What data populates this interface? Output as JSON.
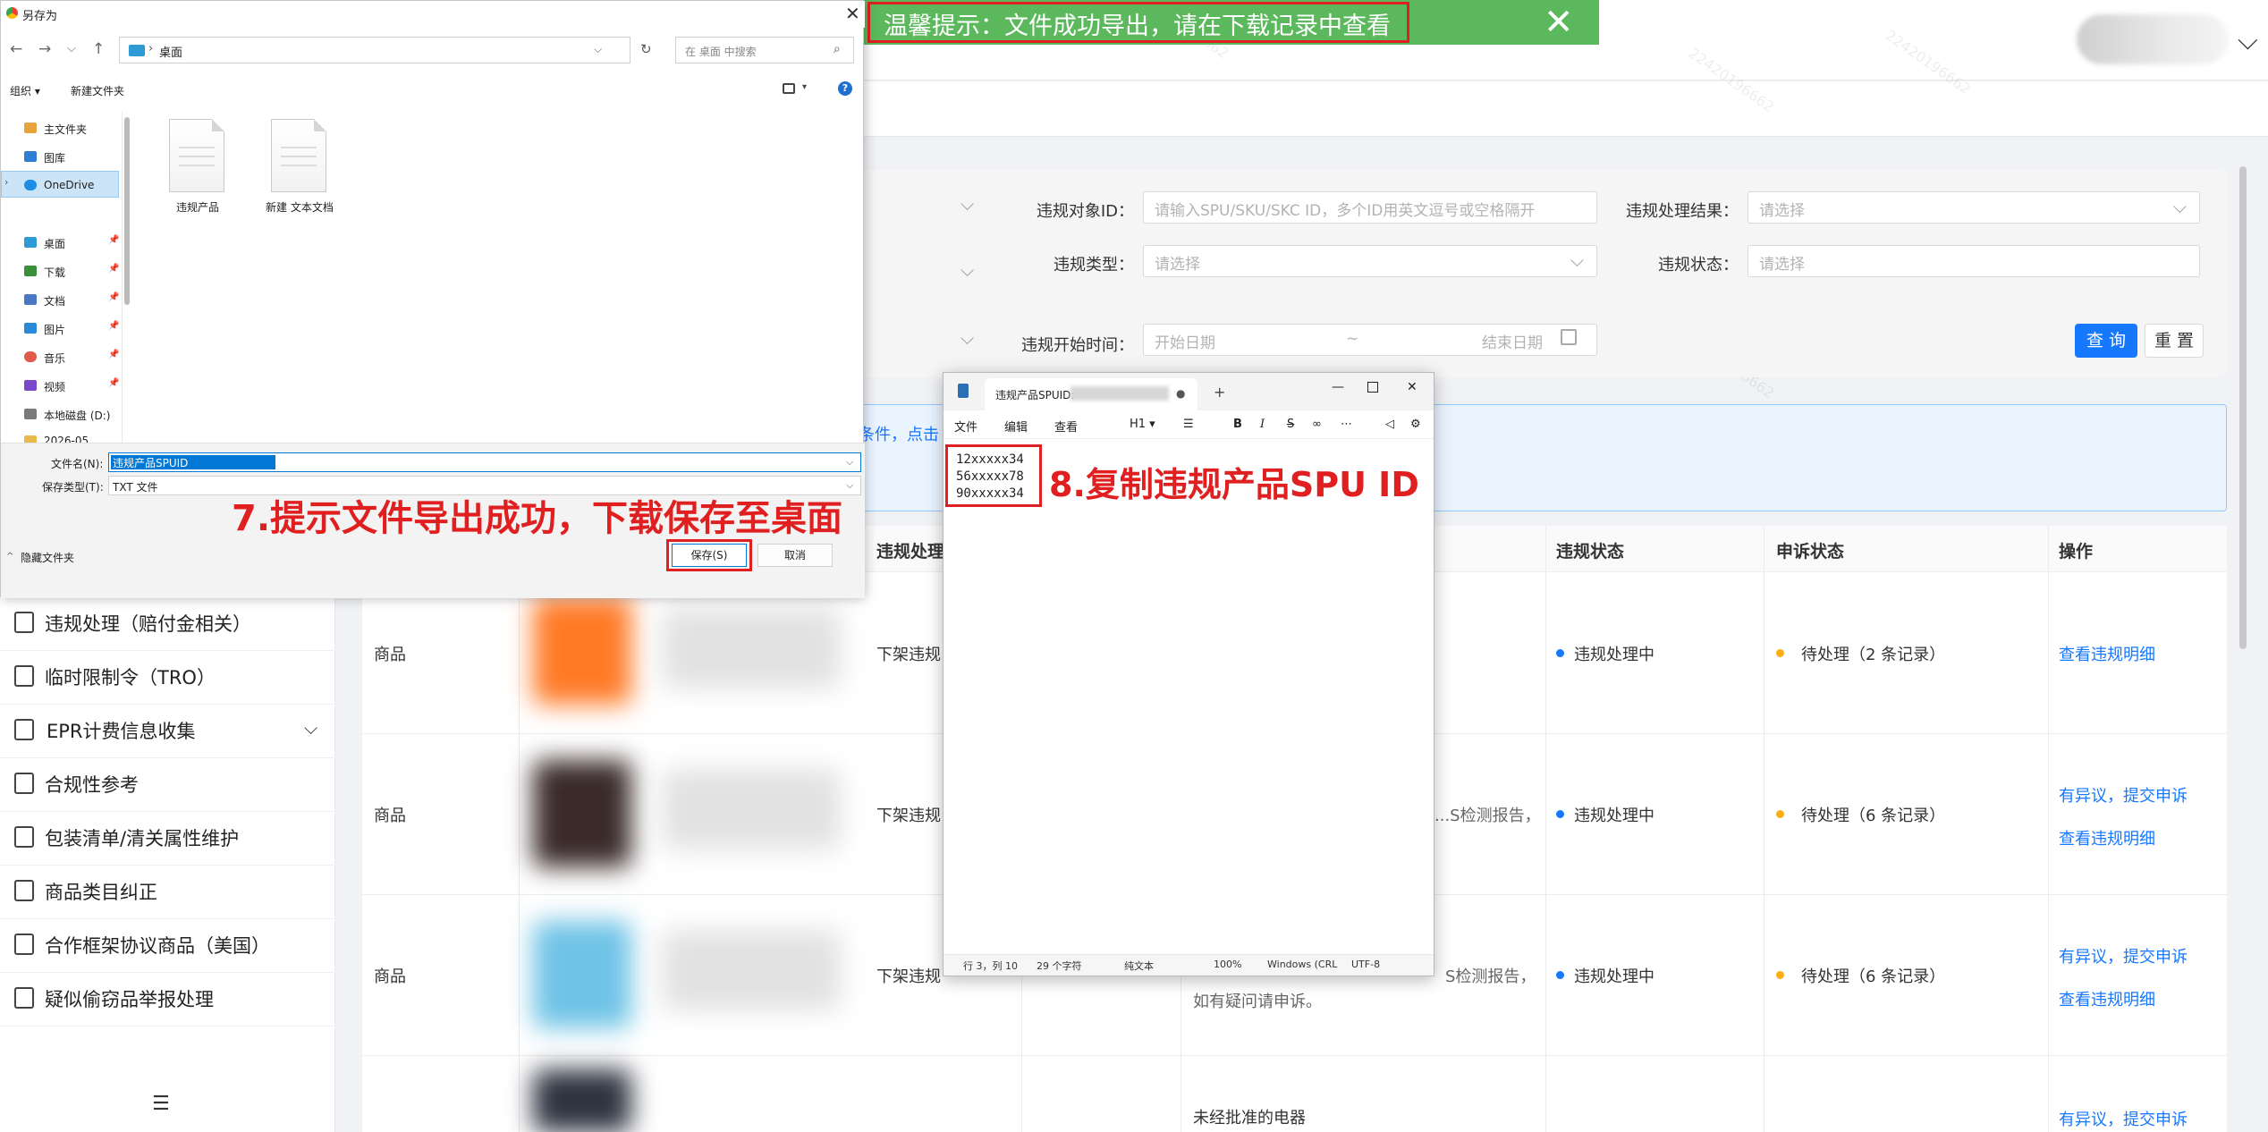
{
  "toast": {
    "text": "温馨提示：文件成功导出，请在下载记录中查看",
    "close": "✕",
    "bg_color": "#5cb85c"
  },
  "filters": {
    "violation_target_id_label": "违规对象ID：",
    "violation_target_id_placeholder": "请输入SPU/SKU/SKC ID，多个ID用英文逗号或空格隔开",
    "violation_result_label": "违规处理结果：",
    "violation_result_placeholder": "请选择",
    "violation_type_label": "违规类型：",
    "violation_type_placeholder": "请选择",
    "violation_status_label": "违规状态：",
    "violation_status_placeholder": "请选择",
    "start_time_label": "违规开始时间：",
    "start_date_placeholder": "开始日期",
    "date_separator": "~",
    "end_date_placeholder": "结束日期",
    "query_button": "查 询",
    "reset_button": "重 置"
  },
  "banner": {
    "text_fragment": "条件，点击"
  },
  "table": {
    "headers": {
      "handling": "违规处理",
      "violation_status": "违规状态",
      "appeal_status": "申诉状态",
      "actions": "操作"
    },
    "rows": [
      {
        "object": "商品",
        "handling": "下架违规",
        "reason": "",
        "violation_status": "违规处理中",
        "appeal_status": "待处理（2 条记录）",
        "actions": [
          "查看违规明细"
        ]
      },
      {
        "object": "商品",
        "handling": "下架违规",
        "reason": "...S检测报告，",
        "violation_status": "违规处理中",
        "appeal_status": "待处理（6 条记录）",
        "actions": [
          "有异议，提交申诉",
          "查看违规明细"
        ]
      },
      {
        "object": "商品",
        "handling": "下架违规",
        "reason": "S检测报告，",
        "reason2": "如有疑问请申诉。",
        "violation_status": "违规处理中",
        "appeal_status": "待处理（6 条记录）",
        "actions": [
          "有异议，提交申诉",
          "查看违规明细"
        ]
      },
      {
        "object": "商品",
        "handling": "",
        "reason": "未经批准的电器",
        "violation_status": "",
        "appeal_status": "",
        "actions": [
          "有异议，提交申诉"
        ]
      }
    ]
  },
  "sidebar": {
    "items": [
      {
        "label": "违规处理（赔付金相关）",
        "icon": "doc-icon"
      },
      {
        "label": "临时限制令（TRO）",
        "icon": "calendar-icon"
      },
      {
        "label": "EPR计费信息收集",
        "icon": "doc-search-icon",
        "expandable": true
      },
      {
        "label": "合规性参考",
        "icon": "book-icon"
      },
      {
        "label": "包装清单/清关属性维护",
        "icon": "list-icon"
      },
      {
        "label": "商品类目纠正",
        "icon": "check-doc-icon"
      },
      {
        "label": "合作框架协议商品（美国）",
        "icon": "gear-doc-icon"
      },
      {
        "label": "疑似偷窃品举报处理",
        "icon": "edit-doc-icon"
      }
    ],
    "collapse_icon": "menu-collapse-icon"
  },
  "save_dialog": {
    "title": "另存为",
    "close": "✕",
    "address": "桌面",
    "search_placeholder": "在 桌面 中搜索",
    "toolbar": {
      "organize": "组织 ▾",
      "new_folder": "新建文件夹"
    },
    "nav": [
      {
        "label": "主文件夹",
        "color": "#e8a33d",
        "pin": false
      },
      {
        "label": "图库",
        "color": "#2d7dd2",
        "pin": false
      },
      {
        "label": "OneDrive",
        "color": "#1f8ce6",
        "pin": false,
        "selected": true
      },
      {
        "label": "桌面",
        "color": "#2f9bd6",
        "pin": true
      },
      {
        "label": "下载",
        "color": "#3a8f3a",
        "pin": true
      },
      {
        "label": "文档",
        "color": "#4a78c2",
        "pin": true
      },
      {
        "label": "图片",
        "color": "#2b8ad8",
        "pin": true
      },
      {
        "label": "音乐",
        "color": "#e05a4a",
        "pin": true
      },
      {
        "label": "视频",
        "color": "#7b48c9",
        "pin": true
      },
      {
        "label": "本地磁盘 (D:)",
        "color": "#7a7a7a",
        "pin": false
      },
      {
        "label": "2026-05",
        "color": "#e8b94a",
        "pin": false
      }
    ],
    "files": [
      "违规产品",
      "新建 文本文档"
    ],
    "filename_label": "文件名(N):",
    "filename_value": "违规产品SPUID",
    "filetype_label": "保存类型(T):",
    "filetype_value": "TXT 文件",
    "hide_folders": "隐藏文件夹",
    "save_button": "保存(S)",
    "cancel_button": "取消"
  },
  "annotations": {
    "step7": "7.提示文件导出成功，下载保存至桌面",
    "step8": "8.复制违规产品SPU ID",
    "color": "#e02020"
  },
  "notepad": {
    "tab_title": "违规产品SPUID:",
    "new_tab": "+",
    "menus": [
      "文件",
      "编辑",
      "查看"
    ],
    "heading": "H1 ▾",
    "lines": [
      "12xxxxx34",
      "56xxxxx78",
      "90xxxxx34"
    ],
    "status": {
      "position": "行 3，列 10",
      "chars": "29 个字符",
      "format": "纯文本",
      "zoom": "100%",
      "line_ending": "Windows (CRL",
      "encoding": "UTF-8"
    }
  }
}
